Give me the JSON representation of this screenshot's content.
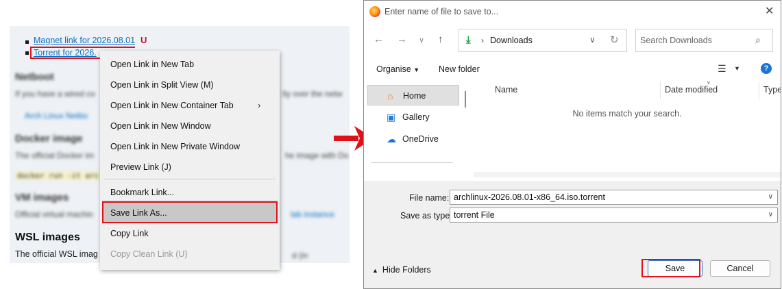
{
  "browser": {
    "links": [
      "Magnet link for 2026.08.01",
      "Torrent for 2026."
    ],
    "magnet_icon": "magnet-icon",
    "blurred": {
      "netboot_heading": "Netboot",
      "netboot_text": "If you have a wired co",
      "netboot_text2": "tly over the netw",
      "netboot_link": "Arch Linux Netbo",
      "docker_heading": "Docker image",
      "docker_text": "The official Docker im",
      "docker_text2": "he image with Do",
      "docker_code": "docker run -it arc",
      "vm_heading": "VM images",
      "vm_text": "Official virtual machin",
      "vm_link": "lab instance",
      "wsl_tail": "d (in"
    },
    "wsl_heading": "WSL images",
    "wsl_text": "The official WSL imag"
  },
  "context_menu": {
    "items": [
      {
        "label": "Open Link in New Tab"
      },
      {
        "label": "Open Link in Split View (M)"
      },
      {
        "label": "Open Link in New Container Tab",
        "submenu": true
      },
      {
        "label": "Open Link in New Window"
      },
      {
        "label": "Open Link in New Private Window"
      },
      {
        "label": "Preview Link (J)"
      },
      {
        "label": "Bookmark Link..."
      },
      {
        "label": "Save Link As..."
      },
      {
        "label": "Copy Link"
      },
      {
        "label": "Copy Clean Link (U)",
        "disabled": true
      }
    ],
    "highlighted": "Save Link As..."
  },
  "dialog": {
    "title": "Enter name of file to save to...",
    "address_location": "Downloads",
    "search_placeholder": "Search Downloads",
    "toolbar": {
      "organise": "Organise",
      "new_folder": "New folder",
      "help": "?"
    },
    "nav_items": [
      {
        "label": "Home",
        "icon": "home-icon",
        "selected": true
      },
      {
        "label": "Gallery",
        "icon": "gallery-icon"
      },
      {
        "label": "OneDrive",
        "icon": "cloud-icon"
      }
    ],
    "columns": [
      "Name",
      "Date modified",
      "Type"
    ],
    "empty_message": "No items match your search.",
    "file_name_label": "File name:",
    "file_name_value": "archlinux-2026.08.01-x86_64.iso.torrent",
    "save_type_label": "Save as type:",
    "save_type_value": "torrent File",
    "hide_folders": "Hide Folders",
    "save_button": "Save",
    "cancel_button": "Cancel"
  },
  "colors": {
    "annotation": "#e0101a",
    "link": "#0a72c2",
    "accent": "#3478d4"
  }
}
